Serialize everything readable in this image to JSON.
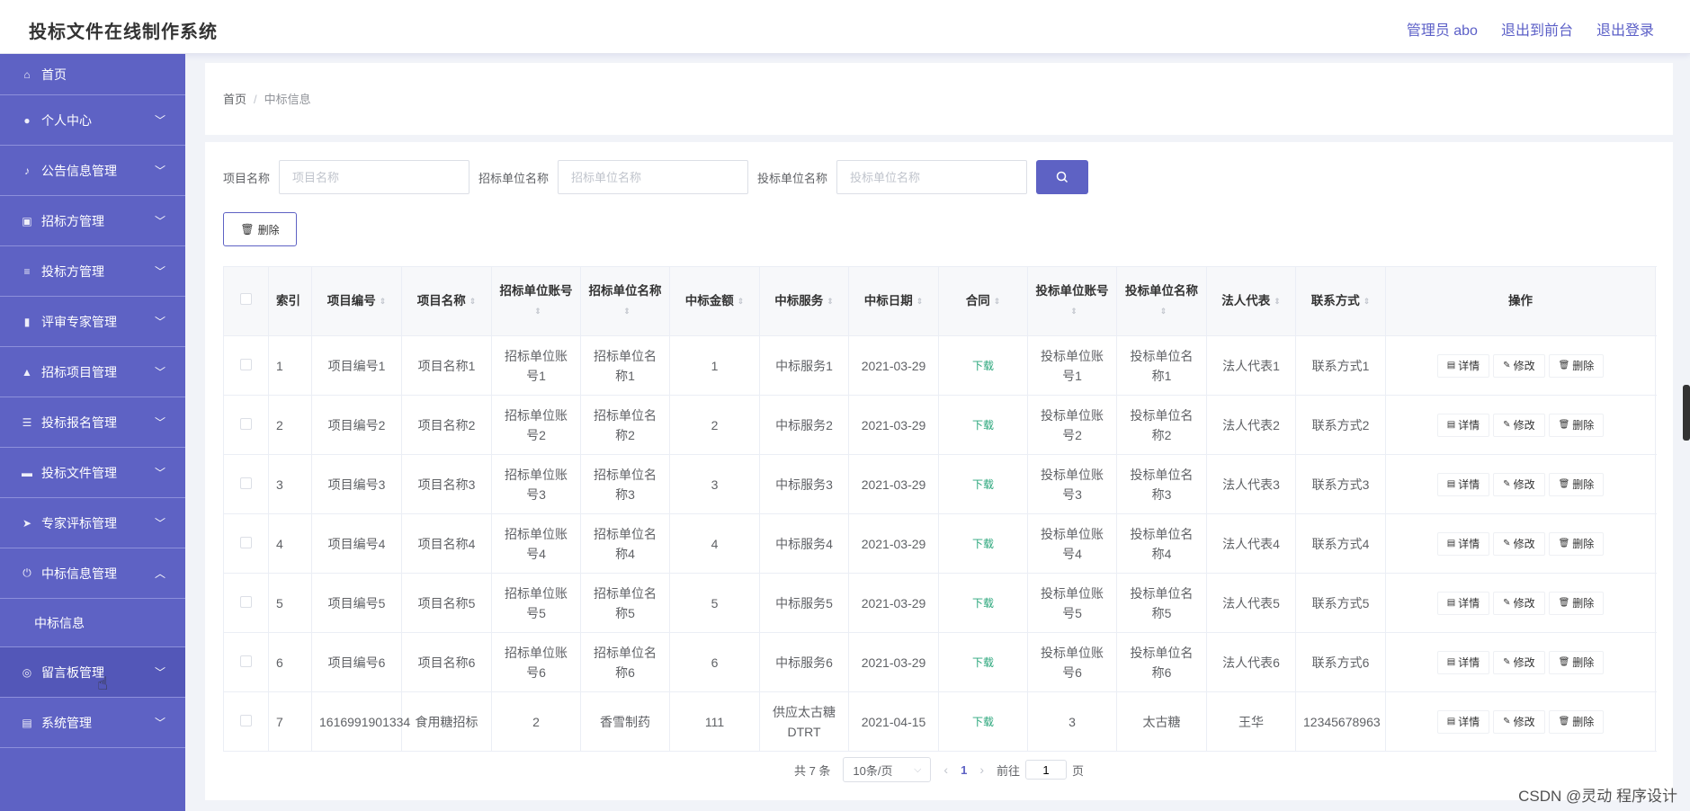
{
  "header": {
    "app_title": "投标文件在线制作系统",
    "admin_label": "管理员 abo",
    "to_front": "退出到前台",
    "logout": "退出登录"
  },
  "sidebar": {
    "items": [
      {
        "label": "首页",
        "icon": "home-icon"
      },
      {
        "label": "个人中心",
        "icon": "user-icon"
      },
      {
        "label": "公告信息管理",
        "icon": "mic-icon"
      },
      {
        "label": "招标方管理",
        "icon": "chart-icon"
      },
      {
        "label": "投标方管理",
        "icon": "list-icon"
      },
      {
        "label": "评审专家管理",
        "icon": "bar-chart-icon"
      },
      {
        "label": "招标项目管理",
        "icon": "thumb-icon"
      },
      {
        "label": "投标报名管理",
        "icon": "sliders-icon"
      },
      {
        "label": "投标文件管理",
        "icon": "chat-icon"
      },
      {
        "label": "专家评标管理",
        "icon": "send-icon"
      },
      {
        "label": "中标信息管理",
        "icon": "power-icon"
      },
      {
        "label": "留言板管理",
        "icon": "compass-icon"
      },
      {
        "label": "系统管理",
        "icon": "clipboard-icon"
      }
    ],
    "sub_item": "中标信息"
  },
  "breadcrumb": {
    "home": "首页",
    "current": "中标信息"
  },
  "search": {
    "project_name_label": "项目名称",
    "project_name_placeholder": "项目名称",
    "tender_unit_label": "招标单位名称",
    "tender_unit_placeholder": "招标单位名称",
    "bid_unit_label": "投标单位名称",
    "bid_unit_placeholder": "投标单位名称"
  },
  "toolbar": {
    "delete_label": "删除"
  },
  "table": {
    "headers": [
      "索引",
      "项目编号",
      "项目名称",
      "招标单位账号",
      "招标单位名称",
      "中标金额",
      "中标服务",
      "中标日期",
      "合同",
      "投标单位账号",
      "投标单位名称",
      "法人代表",
      "联系方式",
      "操作"
    ],
    "rows": [
      {
        "index": "1",
        "code": "项目编号1",
        "name": "项目名称1",
        "t_account": "招标单位账号1",
        "t_name": "招标单位名称1",
        "amount": "1",
        "service": "中标服务1",
        "date": "2021-03-29",
        "contract": "下载",
        "b_account": "投标单位账号1",
        "b_name": "投标单位名称1",
        "legal": "法人代表1",
        "contact": "联系方式1"
      },
      {
        "index": "2",
        "code": "项目编号2",
        "name": "项目名称2",
        "t_account": "招标单位账号2",
        "t_name": "招标单位名称2",
        "amount": "2",
        "service": "中标服务2",
        "date": "2021-03-29",
        "contract": "下载",
        "b_account": "投标单位账号2",
        "b_name": "投标单位名称2",
        "legal": "法人代表2",
        "contact": "联系方式2"
      },
      {
        "index": "3",
        "code": "项目编号3",
        "name": "项目名称3",
        "t_account": "招标单位账号3",
        "t_name": "招标单位名称3",
        "amount": "3",
        "service": "中标服务3",
        "date": "2021-03-29",
        "contract": "下载",
        "b_account": "投标单位账号3",
        "b_name": "投标单位名称3",
        "legal": "法人代表3",
        "contact": "联系方式3"
      },
      {
        "index": "4",
        "code": "项目编号4",
        "name": "项目名称4",
        "t_account": "招标单位账号4",
        "t_name": "招标单位名称4",
        "amount": "4",
        "service": "中标服务4",
        "date": "2021-03-29",
        "contract": "下载",
        "b_account": "投标单位账号4",
        "b_name": "投标单位名称4",
        "legal": "法人代表4",
        "contact": "联系方式4"
      },
      {
        "index": "5",
        "code": "项目编号5",
        "name": "项目名称5",
        "t_account": "招标单位账号5",
        "t_name": "招标单位名称5",
        "amount": "5",
        "service": "中标服务5",
        "date": "2021-03-29",
        "contract": "下载",
        "b_account": "投标单位账号5",
        "b_name": "投标单位名称5",
        "legal": "法人代表5",
        "contact": "联系方式5"
      },
      {
        "index": "6",
        "code": "项目编号6",
        "name": "项目名称6",
        "t_account": "招标单位账号6",
        "t_name": "招标单位名称6",
        "amount": "6",
        "service": "中标服务6",
        "date": "2021-03-29",
        "contract": "下载",
        "b_account": "投标单位账号6",
        "b_name": "投标单位名称6",
        "legal": "法人代表6",
        "contact": "联系方式6"
      },
      {
        "index": "7",
        "code": "1616991901334",
        "name": "食用糖招标",
        "t_account": "2",
        "t_name": "香雪制药",
        "amount": "111",
        "service": "供应太古糖DTRT",
        "date": "2021-04-15",
        "contract": "下载",
        "b_account": "3",
        "b_name": "太古糖",
        "legal": "王华",
        "contact": "12345678963"
      }
    ],
    "ops": {
      "detail": "详情",
      "edit": "修改",
      "delete": "删除"
    }
  },
  "pagination": {
    "total": "共 7 条",
    "page_size": "10条/页",
    "current_page": "1",
    "goto_prefix": "前往",
    "goto_value": "1",
    "goto_suffix": "页"
  },
  "watermark": "CSDN @灵动 程序设计",
  "colors": {
    "accent": "#5e62c4",
    "link_green": "#2aa67b"
  }
}
